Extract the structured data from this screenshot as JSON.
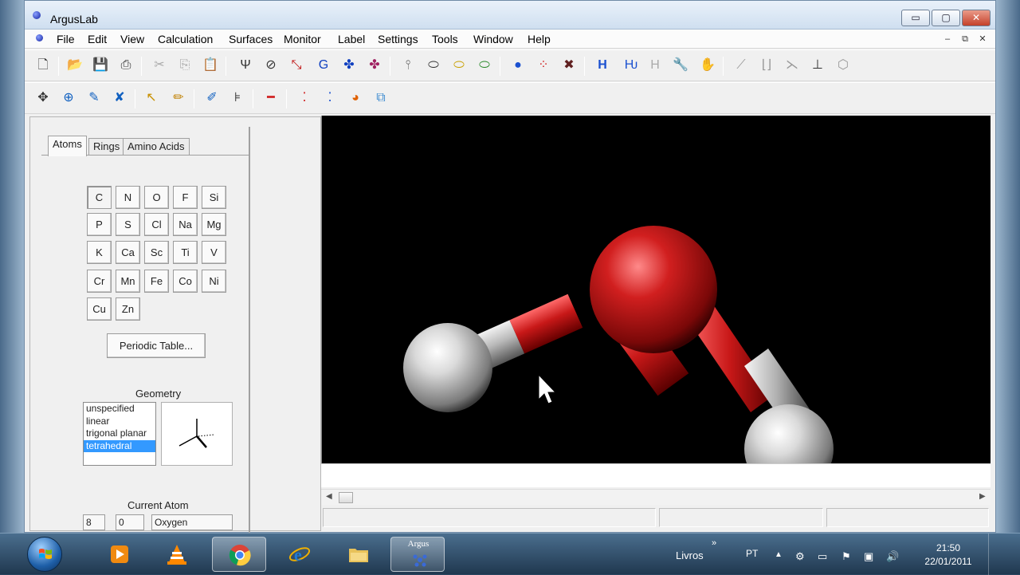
{
  "window": {
    "title": "ArgusLab",
    "controls": {
      "minimize": "▭",
      "maximize": "▢",
      "close": "✕"
    }
  },
  "menubar": {
    "items": [
      "File",
      "Edit",
      "View",
      "Calculation",
      "Surfaces",
      "Monitor",
      "Label",
      "Settings",
      "Tools",
      "Window",
      "Help"
    ],
    "mdi_controls": {
      "minimize": "–",
      "restore": "⧉",
      "close": "✕"
    }
  },
  "left_panel": {
    "tabs": [
      "Atoms",
      "Rings",
      "Amino Acids"
    ],
    "active_tab": "Atoms",
    "elements": [
      [
        "C",
        "N",
        "O",
        "F",
        "Si"
      ],
      [
        "P",
        "S",
        "Cl",
        "Na",
        "Mg"
      ],
      [
        "K",
        "Ca",
        "Sc",
        "Ti",
        "V"
      ],
      [
        "Cr",
        "Mn",
        "Fe",
        "Co",
        "Ni"
      ],
      [
        "Cu",
        "Zn"
      ]
    ],
    "selected_element": "C",
    "periodic_table_button": "Periodic Table...",
    "geometry_label": "Geometry",
    "geometry_options": [
      "unspecified",
      "linear",
      "trigonal planar",
      "tetrahedral"
    ],
    "geometry_selected": "tetrahedral",
    "current_atom_label": "Current Atom",
    "current_atom": {
      "atomic_number": "8",
      "charge": "0",
      "name": "Oxygen"
    }
  },
  "taskbar": {
    "apps": [
      "media-player",
      "vlc",
      "chrome",
      "internet-explorer",
      "explorer-folder",
      "arguslab"
    ],
    "argus_label": "Argus",
    "toolbar_label": "Livros",
    "toolbar_chevron": "»",
    "language": "PT",
    "clock_time": "21:50",
    "clock_date": "22/01/2011"
  },
  "colors": {
    "viewport_bg": "#000000",
    "oxygen": "#d11f1f",
    "hydrogen": "#e8e8e8",
    "selection": "#3399ff"
  }
}
